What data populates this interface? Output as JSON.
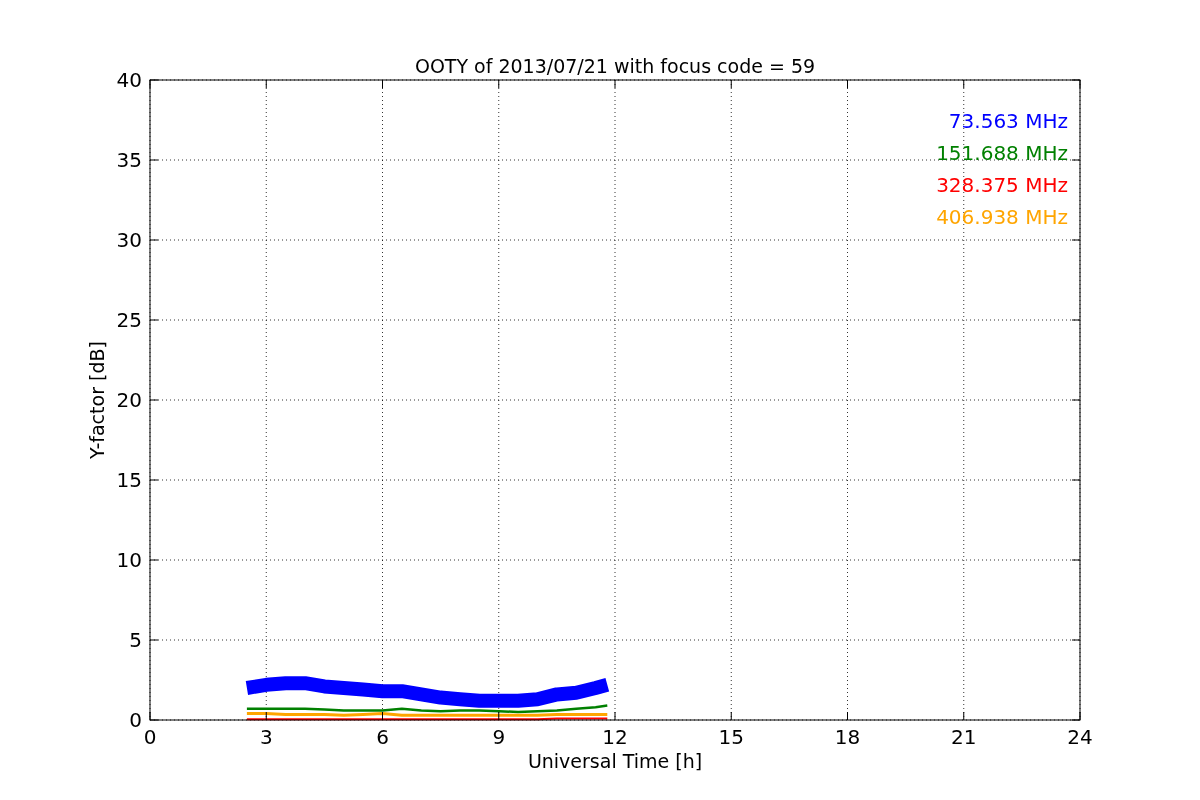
{
  "chart_data": {
    "type": "line",
    "title": "OOTY of 2013/07/21 with focus code = 59",
    "xlabel": "Universal Time [h]",
    "ylabel": "Y-factor [dB]",
    "x": [
      2.5,
      3,
      3.5,
      4,
      4.5,
      5,
      5.5,
      6,
      6.5,
      7,
      7.5,
      8,
      8.5,
      9,
      9.5,
      10,
      10.5,
      11,
      11.5,
      11.8
    ],
    "series": [
      {
        "name": "73.563 MHz",
        "color": "#0000ff",
        "values": [
          2.0,
          2.2,
          2.3,
          2.3,
          2.1,
          2.0,
          1.9,
          1.8,
          1.8,
          1.6,
          1.4,
          1.3,
          1.2,
          1.2,
          1.2,
          1.3,
          1.6,
          1.7,
          2.0,
          2.2
        ]
      },
      {
        "name": "151.688 MHz",
        "color": "#008000",
        "values": [
          0.7,
          0.7,
          0.7,
          0.7,
          0.65,
          0.6,
          0.6,
          0.6,
          0.7,
          0.6,
          0.55,
          0.6,
          0.6,
          0.55,
          0.5,
          0.55,
          0.6,
          0.7,
          0.8,
          0.9
        ]
      },
      {
        "name": "328.375 MHz",
        "color": "#ff0000",
        "values": [
          0.05,
          0.05,
          0.05,
          0.05,
          0.05,
          0.05,
          0.05,
          0.05,
          0.05,
          0.05,
          0.05,
          0.05,
          0.05,
          0.05,
          0.05,
          0.05,
          0.1,
          0.1,
          0.1,
          0.1
        ]
      },
      {
        "name": "406.938 MHz",
        "color": "#ffa500",
        "values": [
          0.4,
          0.4,
          0.35,
          0.35,
          0.35,
          0.3,
          0.35,
          0.4,
          0.3,
          0.3,
          0.3,
          0.3,
          0.3,
          0.3,
          0.3,
          0.3,
          0.35,
          0.35,
          0.35,
          0.35
        ]
      }
    ],
    "xlim": [
      0,
      24
    ],
    "ylim": [
      0,
      40
    ],
    "xticks": [
      0,
      3,
      6,
      9,
      12,
      15,
      18,
      21,
      24
    ],
    "yticks": [
      0,
      5,
      10,
      15,
      20,
      25,
      30,
      35,
      40
    ],
    "grid": true
  }
}
